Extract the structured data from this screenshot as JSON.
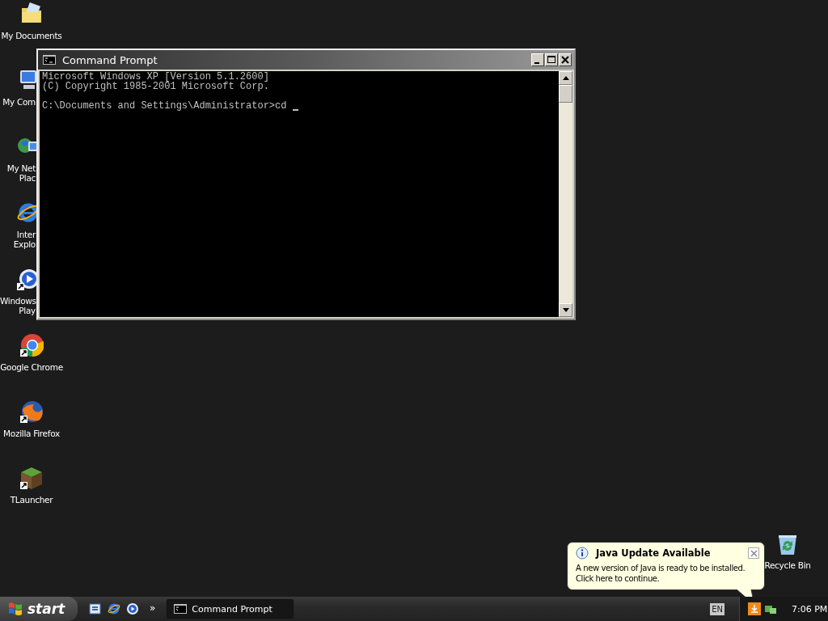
{
  "desktop_icons": [
    {
      "kind": "folder",
      "label": "My Documents",
      "covered": false
    },
    {
      "kind": "computer",
      "label": "My Com",
      "covered": true
    },
    {
      "kind": "network",
      "label": "My Net\nPlac",
      "covered": true
    },
    {
      "kind": "ie",
      "label": "Inter\nExplo",
      "covered": true
    },
    {
      "kind": "media",
      "label": "Windows\nPlay",
      "covered": true
    },
    {
      "kind": "chrome",
      "label": "Google Chrome",
      "covered": false
    },
    {
      "kind": "firefox",
      "label": "Mozilla Firefox",
      "covered": false
    },
    {
      "kind": "grass",
      "label": "TLauncher",
      "covered": false
    }
  ],
  "window": {
    "title": "Command Prompt",
    "output": [
      "Microsoft Windows XP [Version 5.1.2600]",
      "(C) Copyright 1985-2001 Microsoft Corp."
    ],
    "prompt": "C:\\Documents and Settings\\Administrator>cd"
  },
  "recycle_bin": {
    "label": "Recycle Bin"
  },
  "balloon": {
    "title": "Java Update Available",
    "text": "A new version of Java is ready to be installed.\nClick here to continue."
  },
  "taskbar": {
    "start": "start",
    "overflow": "»",
    "tasks": [
      {
        "title": "Command Prompt"
      }
    ],
    "language": "EN",
    "clock": "7:06 PM"
  }
}
